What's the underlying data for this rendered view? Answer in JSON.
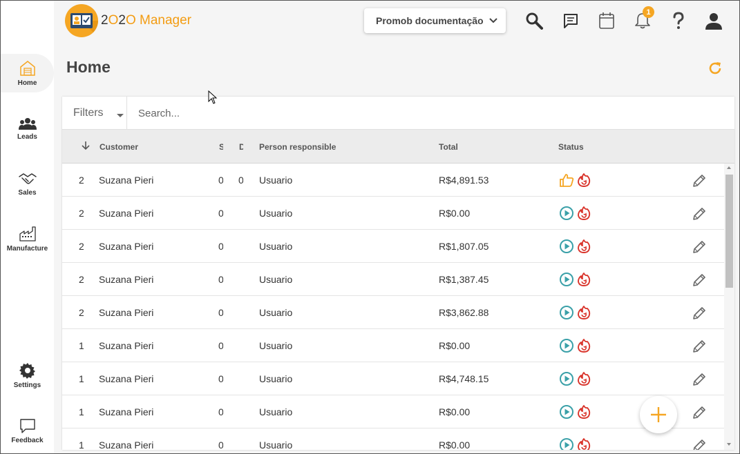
{
  "app": {
    "logo_text_prefix": "2",
    "logo_text_o1": "O",
    "logo_text_mid": "2",
    "logo_text_o2": "O",
    "logo_text_suffix": " Manager",
    "brand_color": "#f5a623"
  },
  "topbar": {
    "project_select": "Promob documentação",
    "notification_count": "1",
    "icons": [
      "search-icon",
      "chat-icon",
      "calendar-icon",
      "bell-icon",
      "help-icon",
      "user-icon"
    ]
  },
  "sidebar": {
    "items": [
      {
        "label": "Home",
        "icon": "home-icon"
      },
      {
        "label": "Leads",
        "icon": "people-icon"
      },
      {
        "label": "Sales",
        "icon": "handshake-icon"
      },
      {
        "label": "Manufacture",
        "icon": "factory-icon"
      },
      {
        "label": "Settings",
        "icon": "gear-icon"
      },
      {
        "label": "Feedback",
        "icon": "feedback-icon"
      }
    ]
  },
  "page": {
    "title": "Home"
  },
  "search": {
    "filters_label": "Filters",
    "placeholder": "Search..."
  },
  "table": {
    "columns": {
      "customer": "Customer",
      "s": "S",
      "d": "D",
      "person": "Person responsible",
      "total": "Total",
      "status": "Status"
    },
    "rows": [
      {
        "num": "2",
        "customer": "Suzana Pieri",
        "s": "0",
        "d": "0",
        "person": "Usuario",
        "total": "R$4,891.53",
        "status": "approved"
      },
      {
        "num": "2",
        "customer": "Suzana Pieri",
        "s": "0",
        "d": "",
        "person": "Usuario",
        "total": "R$0.00",
        "status": "in-progress"
      },
      {
        "num": "2",
        "customer": "Suzana Pieri",
        "s": "0",
        "d": "",
        "person": "Usuario",
        "total": "R$1,807.05",
        "status": "in-progress"
      },
      {
        "num": "2",
        "customer": "Suzana Pieri",
        "s": "0",
        "d": "",
        "person": "Usuario",
        "total": "R$1,387.45",
        "status": "in-progress"
      },
      {
        "num": "2",
        "customer": "Suzana Pieri",
        "s": "0",
        "d": "",
        "person": "Usuario",
        "total": "R$3,862.88",
        "status": "in-progress"
      },
      {
        "num": "1",
        "customer": "Suzana Pieri",
        "s": "0",
        "d": "",
        "person": "Usuario",
        "total": "R$0.00",
        "status": "in-progress"
      },
      {
        "num": "1",
        "customer": "Suzana Pieri",
        "s": "0",
        "d": "",
        "person": "Usuario",
        "total": "R$4,748.15",
        "status": "in-progress"
      },
      {
        "num": "1",
        "customer": "Suzana Pieri",
        "s": "0",
        "d": "",
        "person": "Usuario",
        "total": "R$0.00",
        "status": "in-progress"
      },
      {
        "num": "1",
        "customer": "Suzana Pieri",
        "s": "0",
        "d": "",
        "person": "Usuario",
        "total": "R$0.00",
        "status": "in-progress"
      }
    ]
  },
  "colors": {
    "accent": "#f5a623",
    "play_teal": "#3aa0a8",
    "hot_red": "#d9342b",
    "thumb_orange": "#f5a623"
  }
}
